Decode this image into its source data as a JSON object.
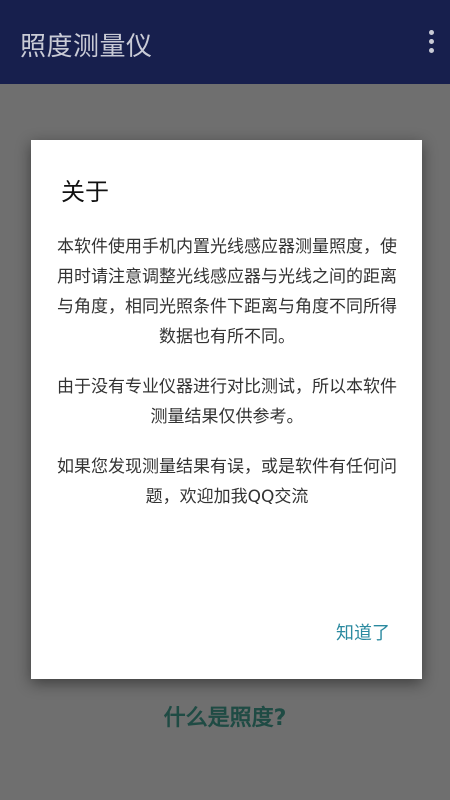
{
  "app": {
    "title": "照度测量仪",
    "menu_icon": "more-vert-icon"
  },
  "page": {
    "what_is_link": "什么是照度?"
  },
  "dialog": {
    "title": "关于",
    "paragraphs": [
      "本软件使用手机内置光线感应器测量照度，使用时请注意调整光线感应器与光线之间的距离与角度，相同光照条件下距离与角度不同所得数据也有所不同。",
      "由于没有专业仪器进行对比测试，所以本软件测量结果仅供参考。",
      "如果您发现测量结果有误，或是软件有任何问题，欢迎加我QQ交流"
    ],
    "ok_button": "知道了"
  },
  "colors": {
    "appbar": "#2a3a8c",
    "scrim": "#6f6f6f",
    "accent": "#2b8aa0"
  }
}
